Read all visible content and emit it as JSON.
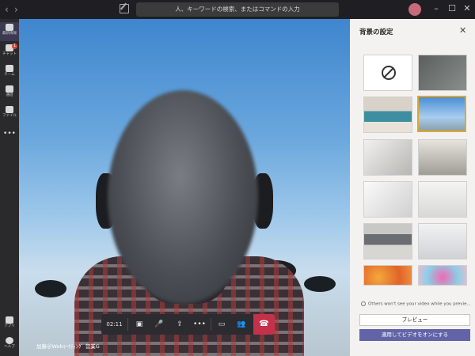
{
  "titlebar": {
    "search_placeholder": "人、キーワードの検索、またはコマンドの入力",
    "back": "‹",
    "forward": "›",
    "minimize": "–",
    "maximize": "☐",
    "close": "✕"
  },
  "rail": {
    "items": [
      {
        "label": "最新情報",
        "icon": "bell-icon",
        "active": true
      },
      {
        "label": "チャット",
        "icon": "chat-icon",
        "badge": "1"
      },
      {
        "label": "チーム",
        "icon": "teams-icon"
      },
      {
        "label": "通話",
        "icon": "phone-icon"
      },
      {
        "label": "ファイル",
        "icon": "file-icon"
      },
      {
        "label": "•••",
        "icon": "more-icon"
      }
    ],
    "apps_label": "アプリ",
    "help_label": "ヘルプ"
  },
  "video": {
    "caption": "加藤＠Webﾏｰｹﾃｨﾝｸﾞ 営業G"
  },
  "controls": {
    "timer": "02:11",
    "camera": "▣",
    "mic": "🎤",
    "share": "⇪",
    "more": "•••",
    "chat": "▭",
    "participants": "👥",
    "hangup": "☎"
  },
  "panel": {
    "title": "背景の設定",
    "close": "✕",
    "notice": "Others won't see your video while you previe...",
    "preview_button": "プレビュー",
    "apply_button": "適用してビデオをオンにする"
  },
  "colors": {
    "accent": "#6264a7",
    "hangup": "#c4314b",
    "selected_border": "#e2a62a"
  }
}
